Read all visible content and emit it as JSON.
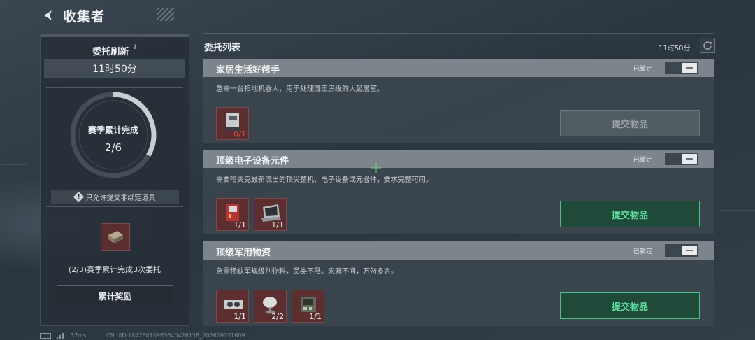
{
  "header": {
    "title": "收集者"
  },
  "left_panel": {
    "refresh_title": "委托刷新",
    "help": "?",
    "refresh_time": "11时50分",
    "progress_label": "赛季累计完成",
    "progress_value": "2/6",
    "progress_fraction": 0.333,
    "note": "只允许提交非绑定道具",
    "reward_text": "(2/3)赛季累计完成3次委托",
    "reward_button": "累计奖励"
  },
  "list": {
    "title": "委托列表",
    "timer": "11时50分",
    "cards": [
      {
        "title": "家居生活好帮手",
        "lock_label": "已锁定",
        "desc": "急需一台扫地机器人，用于处理国王房级的大起居室。",
        "items": [
          {
            "icon": "robot-vacuum-icon",
            "count": "0/1",
            "lacking": true
          }
        ],
        "submit": "提交物品",
        "submit_enabled": false
      },
      {
        "title": "顶级电子设备元件",
        "lock_label": "已锁定",
        "desc": "需要哈夫克最新流出的顶尖整机、电子设备或元器件，要求完整可用。",
        "items": [
          {
            "icon": "server-box-icon",
            "count": "1/1",
            "lacking": false
          },
          {
            "icon": "laptop-icon",
            "count": "1/1",
            "lacking": false
          }
        ],
        "submit": "提交物品",
        "submit_enabled": true
      },
      {
        "title": "顶级军用物资",
        "lock_label": "已锁定",
        "desc": "急需稀缺军规级别物料，品类不限。来源不问，万勿多言。",
        "items": [
          {
            "icon": "gpu-card-icon",
            "count": "1/1",
            "lacking": false
          },
          {
            "icon": "satellite-dish-icon",
            "count": "2/2",
            "lacking": false
          },
          {
            "icon": "circuit-module-icon",
            "count": "1/1",
            "lacking": false
          }
        ],
        "submit": "提交物品",
        "submit_enabled": true
      }
    ]
  },
  "status_bar": {
    "ping": "37ms",
    "uid": "CN UID:1842601096364042613B_202609031609"
  },
  "colors": {
    "accent_green": "#4fbf86",
    "lack_red": "#e24a4a",
    "item_bg": "#5c2e30"
  }
}
